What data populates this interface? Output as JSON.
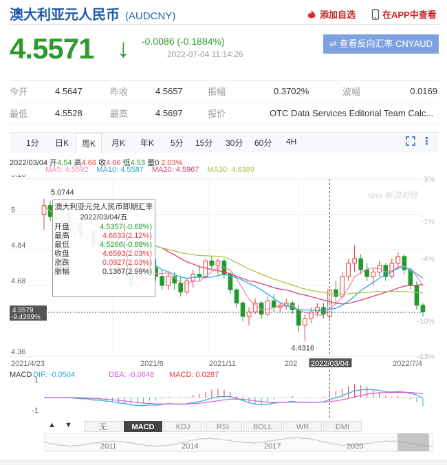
{
  "header": {
    "title": "澳大利亚元人民币",
    "code": "(AUDCNY)",
    "add_watch": "添加自选",
    "view_app": "在APP中查看"
  },
  "quote": {
    "price": "4.5571",
    "change": "-0.0086 (-0.1884%)",
    "time": "2022-07-04 11:14:26",
    "reverse_btn": "⇌ 查看反向汇率 CNYAUD"
  },
  "stats": {
    "open_label": "今开",
    "open": "4.5647",
    "prev_label": "昨收",
    "prev": "4.5657",
    "amp_label": "振幅",
    "amp": "0.3702%",
    "wave_label": "波幅",
    "wave": "0.0169",
    "low_label": "最低",
    "low": "4.5528",
    "high_label": "最高",
    "high": "4.5697",
    "quote_label": "报价",
    "quote_src": "OTC Data Services Editorial Team Calc..."
  },
  "tabs": [
    "1分",
    "日K",
    "周K",
    "月K",
    "年K",
    "5分",
    "15分",
    "30分",
    "60分",
    "4H"
  ],
  "active_tab": "周K",
  "ohlc_line": {
    "date": "2022/03/04",
    "open_label": "开",
    "open": "4.54",
    "high_label": "高",
    "high": "4.66",
    "close_label": "收",
    "close": "4.66",
    "low_label": "低",
    "low": "4.53",
    "vol_label": "量",
    "vol": "0",
    "pct": "2.03%"
  },
  "ma": {
    "ma5": "MA5: 4.5592",
    "ma10": "MA10: 4.5587",
    "ma20": "MA20: 4.5967",
    "ma30": "MA30: 4.6389"
  },
  "colors": {
    "up": "#e4393c",
    "down": "#1f9a2c",
    "ma5": "#f38bb7",
    "ma10": "#29a9e1",
    "ma20": "#e33d6b",
    "ma30": "#a6c54a"
  },
  "chart_data": {
    "type": "candlestick",
    "y_ticks": [
      "5.16",
      "5",
      "4.84",
      "4.68",
      "4.36"
    ],
    "pct_ticks": [
      "3%",
      "-1%",
      "-4%",
      "-10%",
      "-13%"
    ],
    "x_ticks": [
      "2021/4/23",
      "2021/8",
      "2021/11",
      "202",
      "2022/7/4"
    ],
    "cursor_date": "2022/03/04",
    "current_price": "4.5579",
    "current_pct": "-9.4269%",
    "max_label": "5.0744",
    "min_label": "4.4316",
    "ylim": [
      4.36,
      5.16
    ],
    "candles": [
      [
        5.0,
        5.07,
        4.93,
        5.04
      ],
      [
        5.04,
        5.06,
        4.97,
        4.99
      ],
      [
        4.99,
        5.02,
        4.94,
        4.97
      ],
      [
        4.97,
        5.03,
        4.95,
        5.01
      ],
      [
        5.01,
        5.02,
        4.9,
        4.92
      ],
      [
        4.92,
        4.98,
        4.89,
        4.96
      ],
      [
        4.96,
        4.97,
        4.88,
        4.9
      ],
      [
        4.9,
        4.95,
        4.86,
        4.93
      ],
      [
        4.93,
        4.94,
        4.84,
        4.86
      ],
      [
        4.86,
        4.9,
        4.82,
        4.88
      ],
      [
        4.88,
        4.89,
        4.78,
        4.8
      ],
      [
        4.8,
        4.85,
        4.76,
        4.83
      ],
      [
        4.83,
        4.84,
        4.72,
        4.74
      ],
      [
        4.74,
        4.8,
        4.72,
        4.78
      ],
      [
        4.78,
        4.79,
        4.66,
        4.68
      ],
      [
        4.68,
        4.73,
        4.65,
        4.71
      ],
      [
        4.71,
        4.82,
        4.69,
        4.8
      ],
      [
        4.8,
        4.81,
        4.73,
        4.76
      ],
      [
        4.76,
        4.8,
        4.7,
        4.72
      ],
      [
        4.72,
        4.75,
        4.66,
        4.68
      ],
      [
        4.68,
        4.74,
        4.66,
        4.72
      ],
      [
        4.72,
        4.74,
        4.66,
        4.69
      ],
      [
        4.69,
        4.72,
        4.63,
        4.65
      ],
      [
        4.65,
        4.71,
        4.64,
        4.7
      ],
      [
        4.7,
        4.75,
        4.67,
        4.73
      ],
      [
        4.73,
        4.77,
        4.7,
        4.72
      ],
      [
        4.72,
        4.8,
        4.71,
        4.79
      ],
      [
        4.79,
        4.81,
        4.75,
        4.77
      ],
      [
        4.77,
        4.8,
        4.73,
        4.79
      ],
      [
        4.79,
        4.8,
        4.71,
        4.73
      ],
      [
        4.73,
        4.74,
        4.64,
        4.66
      ],
      [
        4.66,
        4.67,
        4.58,
        4.6
      ],
      [
        4.6,
        4.61,
        4.52,
        4.54
      ],
      [
        4.54,
        4.58,
        4.5,
        4.56
      ],
      [
        4.56,
        4.62,
        4.55,
        4.6
      ],
      [
        4.6,
        4.61,
        4.53,
        4.55
      ],
      [
        4.55,
        4.63,
        4.54,
        4.61
      ],
      [
        4.61,
        4.64,
        4.56,
        4.58
      ],
      [
        4.58,
        4.6,
        4.56,
        4.59
      ],
      [
        4.59,
        4.62,
        4.57,
        4.6
      ],
      [
        4.6,
        4.61,
        4.55,
        4.57
      ],
      [
        4.57,
        4.59,
        4.47,
        4.5
      ],
      [
        4.5,
        4.55,
        4.43,
        4.53
      ],
      [
        4.53,
        4.58,
        4.51,
        4.56
      ],
      [
        4.56,
        4.6,
        4.54,
        4.58
      ],
      [
        4.58,
        4.6,
        4.53,
        4.55
      ],
      [
        4.54,
        4.66,
        4.53,
        4.66
      ],
      [
        4.66,
        4.7,
        4.6,
        4.63
      ],
      [
        4.63,
        4.74,
        4.62,
        4.72
      ],
      [
        4.72,
        4.8,
        4.7,
        4.78
      ],
      [
        4.78,
        4.86,
        4.74,
        4.8
      ],
      [
        4.8,
        4.82,
        4.73,
        4.75
      ],
      [
        4.75,
        4.78,
        4.7,
        4.72
      ],
      [
        4.72,
        4.76,
        4.68,
        4.74
      ],
      [
        4.74,
        4.79,
        4.72,
        4.77
      ],
      [
        4.77,
        4.78,
        4.7,
        4.72
      ],
      [
        4.72,
        4.8,
        4.71,
        4.78
      ],
      [
        4.78,
        4.83,
        4.75,
        4.81
      ],
      [
        4.81,
        4.82,
        4.73,
        4.75
      ],
      [
        4.75,
        4.76,
        4.66,
        4.68
      ],
      [
        4.68,
        4.7,
        4.57,
        4.59
      ],
      [
        4.59,
        4.6,
        4.54,
        4.56
      ]
    ],
    "macd": {
      "dif": "DIF: -0.0504",
      "dea": "DEA: -0.0648",
      "macd": "MACD: 0.0287",
      "y_ticks": [
        "1",
        "-1"
      ]
    },
    "indicator_tabs": [
      "无",
      "MACD",
      "KDJ",
      "RSI",
      "BOLL",
      "WR",
      "DMI"
    ],
    "active_indicator": "MACD",
    "range_years": [
      "2011",
      "2014",
      "2017",
      "2020"
    ]
  },
  "tooltip": {
    "title": "澳大利亚元兑人民币即期汇率",
    "date": "2022/03/04/五",
    "rows": [
      {
        "label": "开盘",
        "value": "4.5357(-0.68%)",
        "color": "#1f9a2c"
      },
      {
        "label": "最高",
        "value": "4.6633(2.12%)",
        "color": "#e4393c"
      },
      {
        "label": "最低",
        "value": "4.5266(-0.88%)",
        "color": "#1f9a2c"
      },
      {
        "label": "收盘",
        "value": "4.6593(2.03%)",
        "color": "#e4393c"
      },
      {
        "label": "涨跌",
        "value": "0.0927(2.03%)",
        "color": "#e4393c"
      },
      {
        "label": "振幅",
        "value": "0.1367(2.99%)",
        "color": "#333"
      }
    ]
  },
  "watermark": "sina 新浪财经"
}
